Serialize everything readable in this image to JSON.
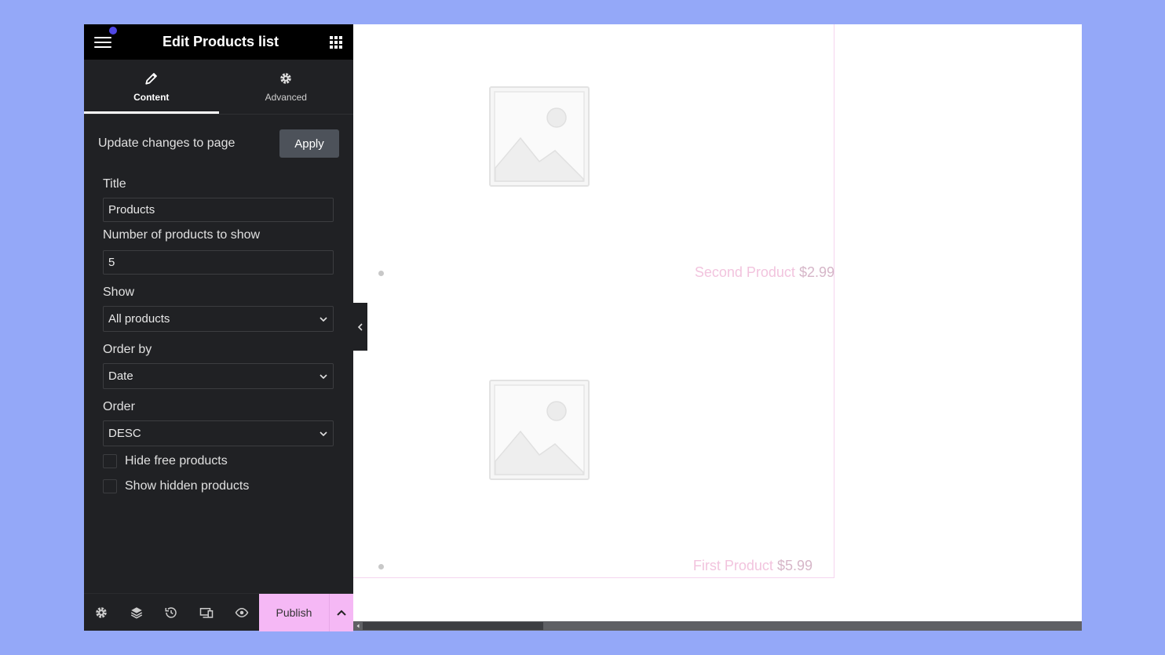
{
  "panel": {
    "title": "Edit Products list",
    "tabs": [
      {
        "label": "Content",
        "icon": "pencil-icon",
        "active": true
      },
      {
        "label": "Advanced",
        "icon": "gear-icon",
        "active": false
      }
    ],
    "apply_label": "Update changes to page",
    "apply_button": "Apply",
    "fields": {
      "title_label": "Title",
      "title_value": "Products",
      "number_label": "Number of products to show",
      "number_value": "5",
      "show_label": "Show",
      "show_value": "All products",
      "orderby_label": "Order by",
      "orderby_value": "Date",
      "order_label": "Order",
      "order_value": "DESC",
      "hide_free_label": "Hide free products",
      "show_hidden_label": "Show hidden products"
    },
    "footer": {
      "icons": [
        "settings-icon",
        "layers-icon",
        "history-icon",
        "responsive-icon",
        "preview-icon"
      ],
      "publish_label": "Publish"
    }
  },
  "colors": {
    "accent": "#f5b8f5",
    "notification_dot": "#4f46e5",
    "background": "#94a8f8"
  },
  "products": [
    {
      "name": "Second Product",
      "price": "$2.99"
    },
    {
      "name": "First Product",
      "price": "$5.99"
    }
  ]
}
